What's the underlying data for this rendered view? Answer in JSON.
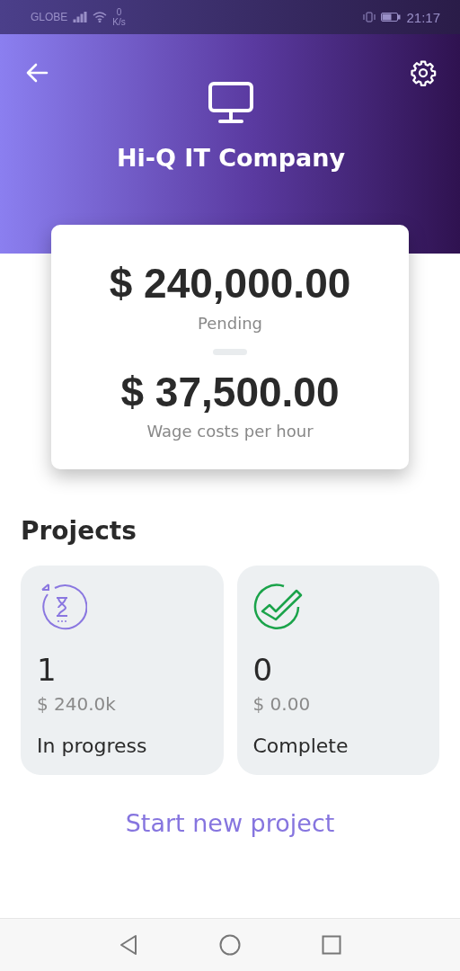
{
  "status_bar": {
    "carrier": "GLOBE",
    "speed_value": "0",
    "speed_unit": "K/s",
    "time": "21:17"
  },
  "header": {
    "company": "Hi-Q IT Company"
  },
  "summary": [
    {
      "amount": "$ 240,000.00",
      "label": "Pending"
    },
    {
      "amount": "$ 37,500.00",
      "label": "Wage costs per hour"
    }
  ],
  "projects": {
    "title": "Projects",
    "cards": [
      {
        "kind": "in_progress",
        "count": "1",
        "amount": "$ 240.0k",
        "label": "In progress"
      },
      {
        "kind": "complete",
        "count": "0",
        "amount": "$ 0.00",
        "label": "Complete"
      }
    ]
  },
  "action": "Start new project"
}
